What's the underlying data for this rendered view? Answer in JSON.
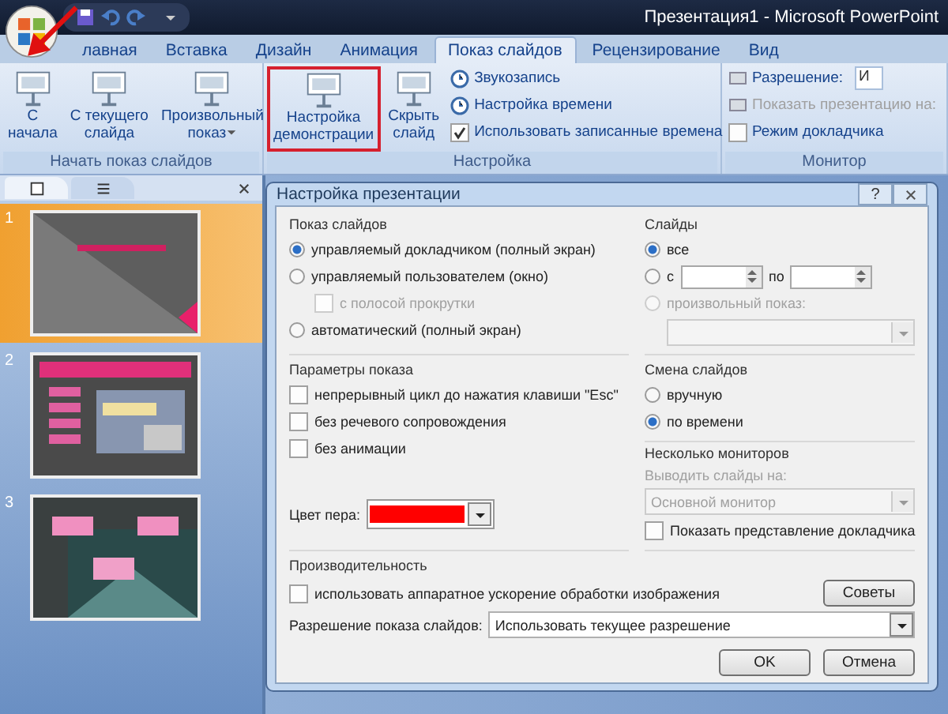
{
  "window": {
    "title": "Презентация1 - Microsoft PowerPoint"
  },
  "tabs": [
    {
      "label": "лавная",
      "selected": false
    },
    {
      "label": "Вставка",
      "selected": false
    },
    {
      "label": "Дизайн",
      "selected": false
    },
    {
      "label": "Анимация",
      "selected": false
    },
    {
      "label": "Показ слайдов",
      "selected": true
    },
    {
      "label": "Рецензирование",
      "selected": false
    },
    {
      "label": "Вид",
      "selected": false
    }
  ],
  "ribbon": {
    "groups": [
      {
        "label": "Начать показ слайдов",
        "large_buttons": [
          {
            "lines": [
              "С",
              "начала"
            ],
            "dropdown": false,
            "highlighted": false
          },
          {
            "lines": [
              "С текущего",
              "слайда"
            ],
            "dropdown": false,
            "highlighted": false
          },
          {
            "lines": [
              "Произвольный",
              "показ"
            ],
            "dropdown": true,
            "highlighted": false
          }
        ]
      },
      {
        "label": "Настройка",
        "large_buttons": [
          {
            "lines": [
              "Настройка",
              "демонстрации"
            ],
            "dropdown": false,
            "highlighted": true
          },
          {
            "lines": [
              "Скрыть",
              "слайд"
            ],
            "dropdown": false,
            "highlighted": false
          }
        ],
        "small_items": [
          {
            "kind": "sound",
            "label": "Звукозапись"
          },
          {
            "kind": "timing",
            "label": "Настройка времени"
          },
          {
            "kind": "checkbox",
            "label": "Использовать записанные времена",
            "checked": true
          }
        ]
      },
      {
        "label": "Монитор",
        "small_items": [
          {
            "kind": "field",
            "label": "Разрешение:",
            "value": "И"
          },
          {
            "kind": "field",
            "label": "Показать презентацию на:",
            "disabled": true
          },
          {
            "kind": "checkbox",
            "label": "Режим докладчика",
            "checked": false
          }
        ]
      }
    ]
  },
  "slide_panel": {
    "slides": [
      {
        "number": "1",
        "selected": true,
        "kind": "picture"
      },
      {
        "number": "2",
        "selected": false,
        "kind": "picture"
      },
      {
        "number": "3",
        "selected": false,
        "kind": "picture"
      }
    ]
  },
  "dialog": {
    "title": "Настройка презентации",
    "help_button": "?",
    "show_type": {
      "title": "Показ слайдов",
      "options": [
        {
          "label": "управляемый докладчиком (полный экран)",
          "selected": true
        },
        {
          "label": "управляемый пользователем (окно)",
          "selected": false
        },
        {
          "label": "автоматический (полный экран)",
          "selected": false
        }
      ],
      "scrollbar_option": {
        "label": "с полосой прокрутки",
        "checked": false,
        "disabled": true
      }
    },
    "slides": {
      "title": "Слайды",
      "options": [
        {
          "kind": "all",
          "label": "все",
          "selected": true,
          "disabled": false
        },
        {
          "kind": "range",
          "label": "с",
          "to_label": "по",
          "selected": false,
          "disabled": false
        },
        {
          "kind": "custom",
          "label": "произвольный показ:",
          "selected": false,
          "disabled": true
        }
      ]
    },
    "show_options": {
      "title": "Параметры показа",
      "checks": [
        {
          "label": "непрерывный цикл до нажатия клавиши \"Esc\"",
          "checked": false
        },
        {
          "label": "без речевого сопровождения",
          "checked": false
        },
        {
          "label": "без анимации",
          "checked": false
        }
      ],
      "pen_color_label": "Цвет пера:",
      "pen_swatch": {
        "color": "#ff0000"
      }
    },
    "advance": {
      "title": "Смена слайдов",
      "options": [
        {
          "label": "вручную",
          "selected": false
        },
        {
          "label": "по времени",
          "selected": true
        }
      ]
    },
    "monitors": {
      "title": "Несколько мониторов",
      "display_label": "Выводить слайды на:",
      "display_value": "Основной монитор",
      "disabled": true,
      "presenter_view": {
        "label": "Показать представление докладчика",
        "checked": false
      }
    },
    "performance": {
      "title": "Производительность",
      "hw_accel": {
        "label": "использовать аппаратное ускорение обработки изображения",
        "checked": false
      },
      "tips_button": "Советы",
      "resolution_label": "Разрешение показа слайдов:",
      "resolution_value": "Использовать текущее разрешение"
    },
    "buttons": [
      "OK",
      "Отмена"
    ]
  }
}
